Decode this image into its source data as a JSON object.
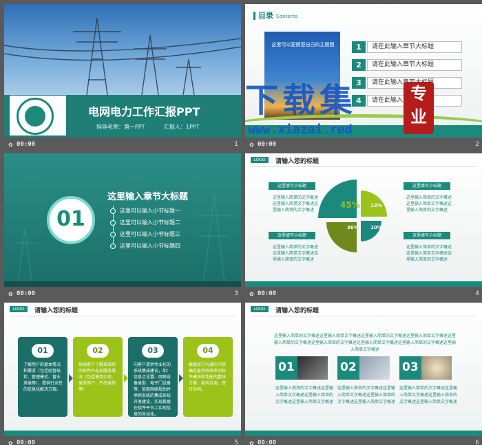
{
  "slides": [
    {
      "number": "1",
      "time": "00:00",
      "title": "电网电力工作汇报PPT",
      "teacher": "指导老师：第一PPT",
      "reporter": "汇报人：1PPT"
    },
    {
      "number": "2",
      "time": "00:00",
      "heading": "目录",
      "heading_en": "Contents",
      "photo_text": "这里可以更换您自己的主题图",
      "items": [
        {
          "n": "1",
          "label": "请在此输入章节大标题"
        },
        {
          "n": "2",
          "label": "请在此输入章节大标题"
        },
        {
          "n": "3",
          "label": "请在此输入章节大标题"
        },
        {
          "n": "4",
          "label": "请在此输入章节大标题"
        }
      ],
      "watermark": {
        "text": "下载集",
        "seal": "专业",
        "url": "www.xiazai.red"
      }
    },
    {
      "number": "3",
      "time": "00:00",
      "circle": "01",
      "title": "这里输入章节大标题",
      "items": [
        "这里可以输入小节标题一",
        "这里可以输入小节标题二",
        "这里可以输入小节标题三",
        "这里可以输入小节标题四"
      ]
    },
    {
      "number": "4",
      "time": "00:00",
      "logo": "LOGO",
      "title": "请输入您的标题",
      "labels": [
        "这里填写小标题",
        "这里填写小标题",
        "这里填写小标题",
        "这里填写小标题"
      ],
      "texts": [
        "这里输入简单的文字概述这里输入简单文字概述这里输入简单的文字概述",
        "这里输入简单的文字概述这里输入简单文字概述这里输入简单的文字概述",
        "这里输入简单的文字概述这里输入简单文字概述这里输入简单的文字概述",
        "这里输入简单的文字概述这里输入简单文字概述这里输入简单的文字概述"
      ],
      "pie": {
        "a": "45%",
        "b": "12%",
        "c": "36%",
        "d": "10%"
      }
    },
    {
      "number": "5",
      "time": "00:00",
      "logo": "LOGO",
      "title": "请输入您的标题",
      "cards": [
        {
          "n": "01",
          "text": "了解用户的基本情况和需求（包括经营现状、管理模式、营业务类等），提供针对性的信息化解决方案。"
        },
        {
          "n": "02",
          "text": "协助客户了解其采购的软件产品及服务情况（包括使用公司、类型用户、产品类型等）"
        },
        {
          "n": "03",
          "text": "向客户提供专业化的系统集成建议，如：信息点设置、网络设备类型、电子门设备等、智能网络规划并承担系统的集成系统开发建设，实现数据在软件平台上实现信息的自动化。"
        },
        {
          "n": "04",
          "text": "根据双方沟通的内容确定最具有效率的软件模块和功能的整体方案、商务洽谈、签订合同。"
        }
      ]
    },
    {
      "number": "6",
      "time": "00:00",
      "logo": "LOGO",
      "title": "请输入您的标题",
      "intro": "这里输入简单的文字概述这里输入简单文字概述这里输入简单的文字概述这里输入简单文字概述这里输入简单的文字概述这里输入简单的文字概述这里输入简单文字概述这里输入简单的文字概述这里输入简单文字概述",
      "blocks": [
        {
          "n": "01",
          "text": "这里输入简单的文字概述这里输入简单文字概述这里输入简单的文字概述这里输入简单文字概述"
        },
        {
          "n": "02",
          "text": "这里输入简单的文字概述这里输入简单文字概述这里输入简单的文字概述这里输入简单文字概述"
        },
        {
          "n": "03",
          "text": "这里输入简单的文字概述这里输入简单文字概述这里输入简单的文字概述这里输入简单文字概述"
        }
      ]
    }
  ],
  "colors": {
    "teal": "#1b8a7c",
    "green": "#9cc31a",
    "olive": "#6f8a1c",
    "background": "#5a5a5a"
  },
  "icons": {
    "play": "play-icon"
  }
}
